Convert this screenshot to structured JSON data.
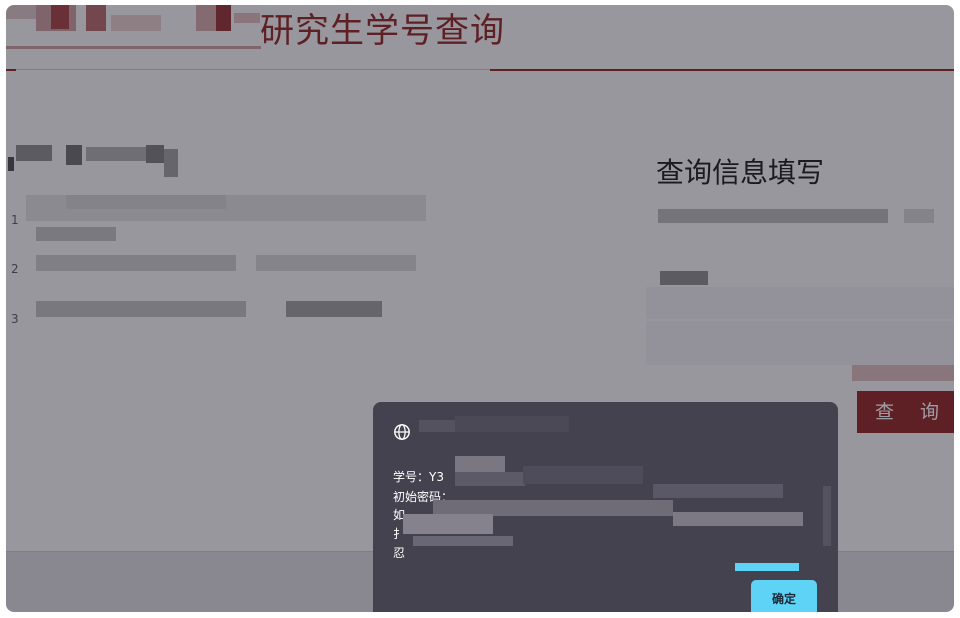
{
  "header": {
    "title": "研究生学号查询"
  },
  "notice": {
    "items": [
      "1",
      "2",
      "3"
    ]
  },
  "query_panel": {
    "title": "查询信息填写",
    "submit_label": "查 询"
  },
  "dialog": {
    "student_id_label": "学号：Y3",
    "initial_password_label": "初始密码：",
    "line3": "如",
    "line4": "扌",
    "line5": "忍",
    "confirm_label": "确定"
  },
  "colors": {
    "brand": "#8b1a1a",
    "accent": "#5fd3f5",
    "dialog_bg": "#454250"
  },
  "icons": {
    "dialog_icon": "globe-icon"
  }
}
